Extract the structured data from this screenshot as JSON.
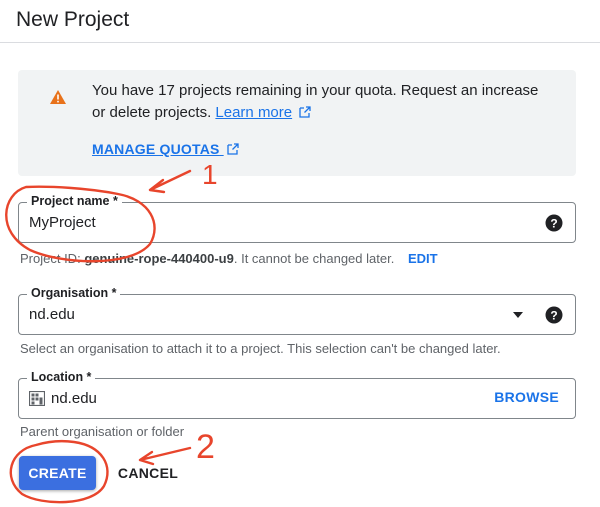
{
  "page": {
    "title": "New Project"
  },
  "quota_banner": {
    "icon": "warning-icon",
    "message": "You have 17 projects remaining in your quota. Request an increase or delete projects.",
    "learn_more": "Learn more",
    "manage_quotas": "MANAGE QUOTAS"
  },
  "project_name": {
    "label": "Project name *",
    "value": "MyProject",
    "id_prefix": "Project ID:",
    "id_value": "genuine-rope-440400-u9",
    "id_note": ". It cannot be changed later.",
    "edit_label": "EDIT"
  },
  "organisation": {
    "label": "Organisation *",
    "value": "nd.edu",
    "helper": "Select an organisation to attach it to a project. This selection can't be changed later."
  },
  "location": {
    "label": "Location *",
    "value": "nd.edu",
    "browse_label": "BROWSE",
    "helper": "Parent organisation or folder"
  },
  "actions": {
    "create_label": "CREATE",
    "cancel_label": "CANCEL"
  },
  "annotations": {
    "label_1": "1",
    "label_2": "2",
    "color": "#e8452c"
  },
  "colors": {
    "accent": "#1a73e8",
    "primary_button": "#3b6fe0",
    "warning": "#e8711a"
  }
}
